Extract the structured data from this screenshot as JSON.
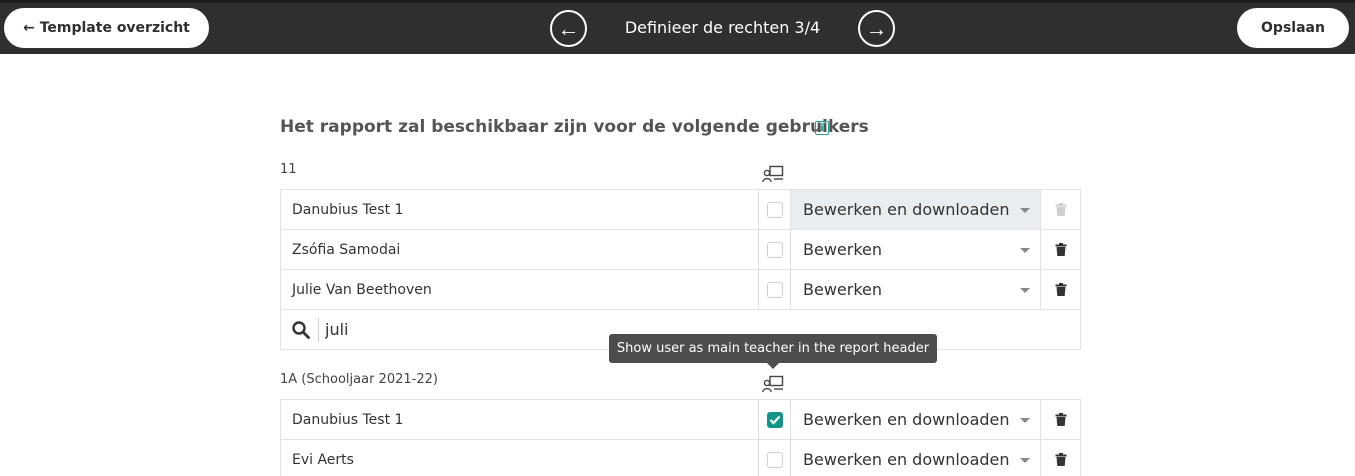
{
  "header": {
    "back_label": "← Template overzicht",
    "prev_glyph": "←",
    "step_title": "Definieer de rechten 3/4",
    "next_glyph": "→",
    "save_label": "Opslaan"
  },
  "section": {
    "title": "Het rapport zal beschikbaar zijn voor de volgende gebruikers",
    "info_glyph": "i"
  },
  "groups": [
    {
      "label": "11",
      "rows": [
        {
          "name": "Danubius Test 1",
          "main_teacher": false,
          "permission": "Bewerken en downloaden",
          "disabled": true
        },
        {
          "name": "Zsófia Samodai",
          "main_teacher": false,
          "permission": "Bewerken",
          "disabled": false
        },
        {
          "name": "Julie Van Beethoven",
          "main_teacher": false,
          "permission": "Bewerken",
          "disabled": false
        }
      ],
      "search_value": "juli"
    },
    {
      "label": "1A (Schooljaar 2021-22)",
      "rows": [
        {
          "name": "Danubius Test 1",
          "main_teacher": true,
          "permission": "Bewerken en downloaden",
          "disabled": false
        },
        {
          "name": "Evi Aerts",
          "main_teacher": false,
          "permission": "Bewerken en downloaden",
          "disabled": false
        }
      ]
    }
  ],
  "tooltip": {
    "text": "Show user as main teacher in the report header"
  },
  "colors": {
    "header_bg": "#2f2f2f",
    "accent": "#12968a",
    "info": "#20a090"
  }
}
